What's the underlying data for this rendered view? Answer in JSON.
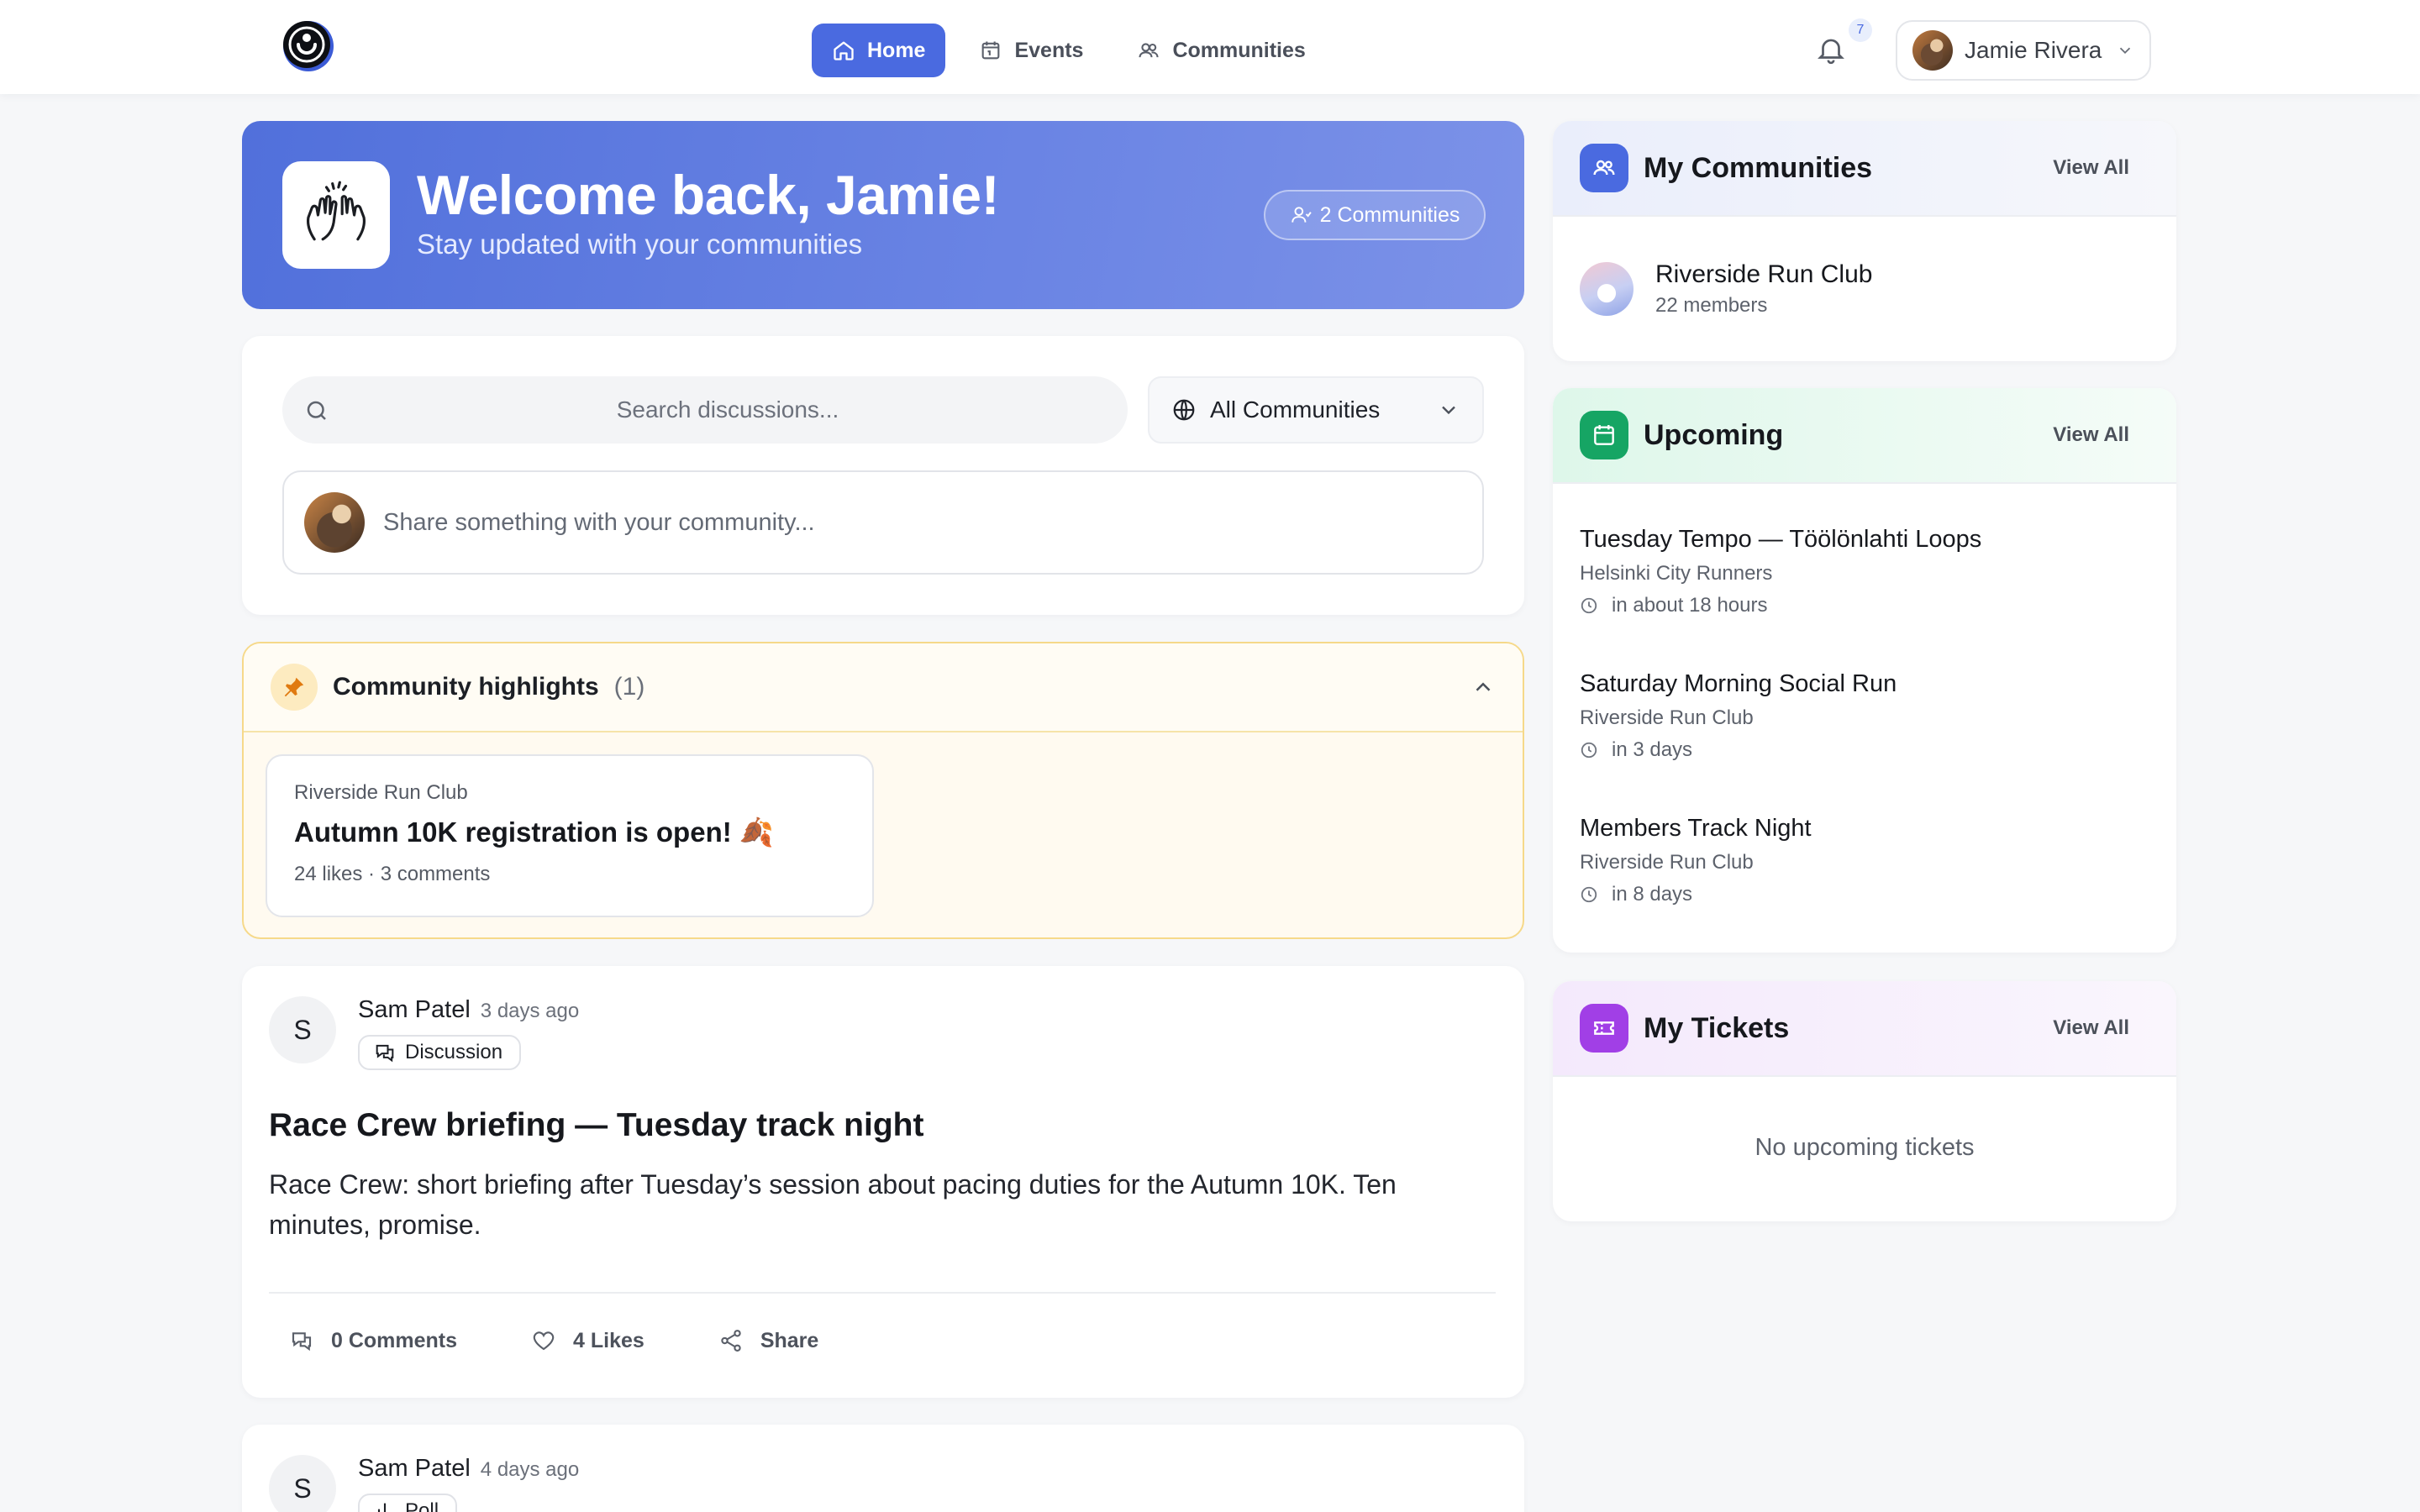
{
  "nav": {
    "items": [
      {
        "label": "Home",
        "icon": "home-icon",
        "active": true
      },
      {
        "label": "Events",
        "icon": "calendar-icon",
        "active": false
      },
      {
        "label": "Communities",
        "icon": "users-icon",
        "active": false
      }
    ],
    "notification_count": "7",
    "user_name": "Jamie Rivera"
  },
  "welcome": {
    "title": "Welcome back, Jamie!",
    "subtitle": "Stay updated with your communities",
    "communities_badge": "2 Communities"
  },
  "search": {
    "placeholder": "Search discussions...",
    "filter_label": "All Communities",
    "composer_placeholder": "Share something with your community..."
  },
  "highlights": {
    "title": "Community highlights",
    "count": "(1)",
    "items": [
      {
        "community": "Riverside Run Club",
        "title": "Autumn 10K registration is open! 🍂",
        "meta": "24 likes · 3 comments"
      }
    ]
  },
  "posts": [
    {
      "avatar_letter": "S",
      "author": "Sam Patel",
      "time": "3 days ago",
      "tag": "Discussion",
      "title": "Race Crew briefing — Tuesday track night",
      "body": "Race Crew: short briefing after Tuesday’s session about pacing duties for the Autumn 10K. Ten minutes, promise.",
      "actions": {
        "comments": "0 Comments",
        "likes": "4 Likes",
        "share": "Share"
      }
    },
    {
      "avatar_letter": "S",
      "author": "Sam Patel",
      "time": "4 days ago",
      "tag": "Poll"
    }
  ],
  "sidebar": {
    "communities": {
      "title": "My Communities",
      "view_all": "View All",
      "items": [
        {
          "name": "Riverside Run Club",
          "members": "22 members"
        }
      ]
    },
    "upcoming": {
      "title": "Upcoming",
      "view_all": "View All",
      "events": [
        {
          "title": "Tuesday Tempo — Töölönlahti Loops",
          "org": "Helsinki City Runners",
          "when": "in about 18 hours"
        },
        {
          "title": "Saturday Morning Social Run",
          "org": "Riverside Run Club",
          "when": "in 3 days"
        },
        {
          "title": "Members Track Night",
          "org": "Riverside Run Club",
          "when": "in 8 days"
        }
      ]
    },
    "tickets": {
      "title": "My Tickets",
      "view_all": "View All",
      "empty": "No upcoming tickets"
    }
  },
  "colors": {
    "accent": "#4a6ae0",
    "upcoming_accent": "#16a564",
    "tickets_accent": "#a13fe6",
    "highlight_border": "#f6d98a"
  }
}
